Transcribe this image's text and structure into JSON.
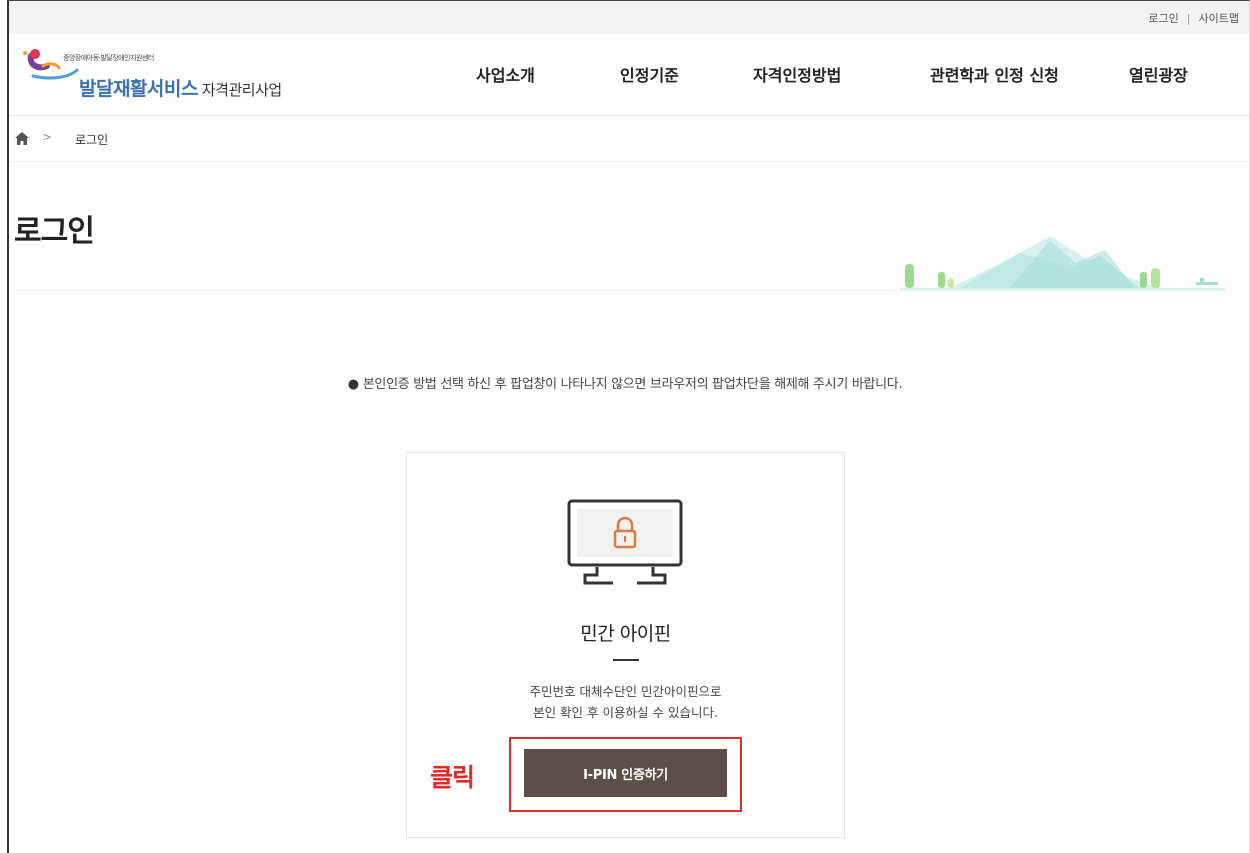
{
  "util": {
    "login": "로그인",
    "separator": "|",
    "sitemap": "사이트맵"
  },
  "logo": {
    "small_text": "중앙장애아동·발달장애인지원센터",
    "main_text": "발달재활서비스",
    "sub_text": "자격관리사업"
  },
  "nav": [
    "사업소개",
    "인정기준",
    "자격인정방법",
    "관련학과 인정 신청",
    "열린광장"
  ],
  "breadcrumb": {
    "separator": ">",
    "current": "로그인"
  },
  "page": {
    "title": "로그인",
    "notice_bullet": "●",
    "notice": "본인인증 방법 선택 하신 후 팝업창이 나타나지 않으면 브라우저의 팝업차단을 해제해 주시기 바랍니다."
  },
  "card": {
    "title": "민간 아이핀",
    "desc_line1": "주민번호 대체수단인 민간아이핀으로",
    "desc_line2": "본인 확인 후 이용하실 수 있습니다.",
    "button": "I-PIN 인증하기"
  },
  "annotation": {
    "click_label": "클릭"
  },
  "colors": {
    "accent_blue": "#3d6fb6",
    "button_bg": "#5b4f47",
    "highlight_red": "#e02b2b",
    "lock_orange": "#e07a3a"
  }
}
